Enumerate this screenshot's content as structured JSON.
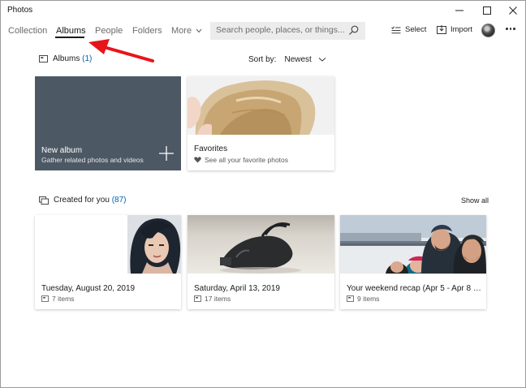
{
  "window": {
    "title": "Photos"
  },
  "nav": {
    "tabs": [
      "Collection",
      "Albums",
      "People",
      "Folders",
      "More"
    ],
    "active": "Albums",
    "search_placeholder": "Search people, places, or things...",
    "select_label": "Select",
    "import_label": "Import"
  },
  "albums": {
    "heading": "Albums",
    "count": "(1)",
    "sort_label": "Sort by:",
    "sort_value": "Newest",
    "new_album": {
      "title": "New album",
      "subtitle": "Gather related photos and videos"
    },
    "favorites": {
      "title": "Favorites",
      "subtitle": "See all your favorite photos"
    }
  },
  "created": {
    "heading": "Created for you",
    "count": "(87)",
    "show_all": "Show all",
    "items": [
      {
        "title": "Tuesday, August 20, 2019",
        "count": "7 items"
      },
      {
        "title": "Saturday, April 13, 2019",
        "count": "17 items"
      },
      {
        "title": "Your weekend recap (Apr 5 - Apr 8 201...",
        "count": "9 items"
      }
    ]
  },
  "colors": {
    "accent": "#0063b1",
    "new_album_tile": "#4d5865",
    "annotation_arrow": "#e8141c",
    "search_bg": "#ececec"
  },
  "icons": [
    "minimize-icon",
    "maximize-icon",
    "close-icon",
    "chevron-down-icon",
    "search-icon",
    "select-icon",
    "import-icon",
    "more-icon",
    "album-icon",
    "plus-icon",
    "heart-icon",
    "created-icon",
    "items-icon",
    "arrow-annotation"
  ]
}
